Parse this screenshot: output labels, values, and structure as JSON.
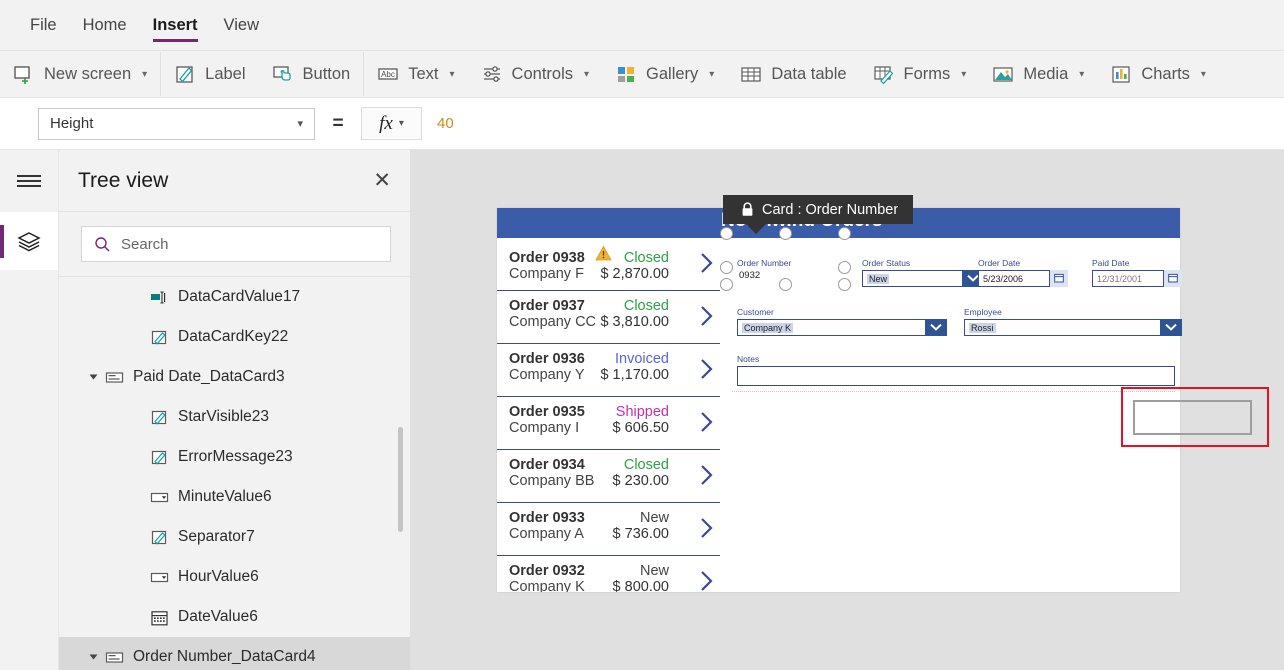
{
  "menu": {
    "items": [
      {
        "label": "File",
        "active": false
      },
      {
        "label": "Home",
        "active": false
      },
      {
        "label": "Insert",
        "active": true
      },
      {
        "label": "View",
        "active": false
      }
    ]
  },
  "ribbon": {
    "groups": [
      {
        "items": [
          {
            "label": "New screen",
            "icon": "new-screen-icon",
            "caret": true
          }
        ]
      },
      {
        "items": [
          {
            "label": "Label",
            "icon": "label-icon",
            "caret": false
          },
          {
            "label": "Button",
            "icon": "button-icon",
            "caret": false
          }
        ]
      },
      {
        "items": [
          {
            "label": "Text",
            "icon": "text-icon",
            "caret": true
          },
          {
            "label": "Controls",
            "icon": "controls-icon",
            "caret": true
          },
          {
            "label": "Gallery",
            "icon": "gallery-icon",
            "caret": true
          },
          {
            "label": "Data table",
            "icon": "data-table-icon",
            "caret": false
          },
          {
            "label": "Forms",
            "icon": "forms-icon",
            "caret": true
          },
          {
            "label": "Media",
            "icon": "media-icon",
            "caret": true
          },
          {
            "label": "Charts",
            "icon": "charts-icon",
            "caret": true
          }
        ]
      }
    ]
  },
  "formula_bar": {
    "property": "Height",
    "equals": "=",
    "fx_label": "fx",
    "value": "40"
  },
  "tree_view": {
    "title": "Tree view",
    "close_label": "✕",
    "search_placeholder": "Search",
    "search_value": "",
    "items": [
      {
        "label": "DataCardValue17",
        "indent": 2,
        "icon": "textinput-icon",
        "caret": false,
        "selected": false
      },
      {
        "label": "DataCardKey22",
        "indent": 2,
        "icon": "label-pencil-icon",
        "caret": false,
        "selected": false
      },
      {
        "label": "Paid Date_DataCard3",
        "indent": 1,
        "icon": "datacard-icon",
        "caret": true,
        "selected": false
      },
      {
        "label": "StarVisible23",
        "indent": 2,
        "icon": "label-pencil-icon",
        "caret": false,
        "selected": false
      },
      {
        "label": "ErrorMessage23",
        "indent": 2,
        "icon": "label-pencil-icon",
        "caret": false,
        "selected": false
      },
      {
        "label": "MinuteValue6",
        "indent": 2,
        "icon": "dropdown-icon",
        "caret": false,
        "selected": false
      },
      {
        "label": "Separator7",
        "indent": 2,
        "icon": "label-pencil-icon",
        "caret": false,
        "selected": false
      },
      {
        "label": "HourValue6",
        "indent": 2,
        "icon": "dropdown-icon",
        "caret": false,
        "selected": false
      },
      {
        "label": "DateValue6",
        "indent": 2,
        "icon": "calendar-icon",
        "caret": false,
        "selected": false
      },
      {
        "label": "Order Number_DataCard4",
        "indent": 1,
        "icon": "datacard-icon",
        "caret": true,
        "selected": true
      }
    ]
  },
  "canvas": {
    "app_title": "Northwind Orders",
    "banner_color": "#3b5ca8",
    "gallery": {
      "rows": [
        {
          "order": "Order 0938",
          "company": "Company F",
          "status": "Closed",
          "status_color": "#2ea043",
          "amount": "$ 2,870.00",
          "warning": true
        },
        {
          "order": "Order 0937",
          "company": "Company CC",
          "status": "Closed",
          "status_color": "#2ea043",
          "amount": "$ 3,810.00",
          "warning": false
        },
        {
          "order": "Order 0936",
          "company": "Company Y",
          "status": "Invoiced",
          "status_color": "#5566dd",
          "amount": "$ 1,170.00",
          "warning": false
        },
        {
          "order": "Order 0935",
          "company": "Company I",
          "status": "Shipped",
          "status_color": "#c030b0",
          "amount": "$ 606.50",
          "warning": false
        },
        {
          "order": "Order 0934",
          "company": "Company BB",
          "status": "Closed",
          "status_color": "#2ea043",
          "amount": "$ 230.00",
          "warning": false
        },
        {
          "order": "Order 0933",
          "company": "Company A",
          "status": "New",
          "status_color": "#444444",
          "amount": "$ 736.00",
          "warning": false
        },
        {
          "order": "Order 0932",
          "company": "Company K",
          "status": "New",
          "status_color": "#444444",
          "amount": "$ 800.00",
          "warning": false
        }
      ]
    },
    "form": {
      "fields": [
        {
          "label": "Order Number",
          "value": "0932",
          "type": "text",
          "highlight": false
        },
        {
          "label": "Order Status",
          "value": "New",
          "type": "dropdown",
          "highlight": true
        },
        {
          "label": "Order Date",
          "value": "5/23/2006",
          "type": "date",
          "highlight": false
        },
        {
          "label": "Paid Date",
          "value": "12/31/2001",
          "type": "date",
          "highlight": false
        },
        {
          "label": "Customer",
          "value": "Company K",
          "type": "dropdown",
          "highlight": true
        },
        {
          "label": "Employee",
          "value": "Rossi",
          "type": "dropdown",
          "highlight": true
        },
        {
          "label": "Notes",
          "value": "",
          "type": "textarea",
          "highlight": false
        }
      ]
    },
    "selection": {
      "tooltip_text": "Card : Order Number",
      "lock_icon": "lock-icon",
      "outline_color": "#e81123"
    }
  }
}
